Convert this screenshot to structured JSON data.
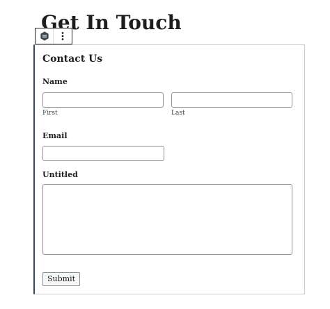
{
  "page": {
    "heading": "Get In Touch"
  },
  "toolbar": {
    "block_icon": "form-block-icon",
    "options_icon": "more-vertical-icon"
  },
  "form": {
    "title": "Contact Us",
    "name_label": "Name",
    "first_label": "First",
    "last_label": "Last",
    "email_label": "Email",
    "untitled_label": "Untitled",
    "submit_label": "Submit"
  },
  "colors": {
    "selection_border": "#3a4752",
    "text": "#1e1e1e",
    "input_border": "#8c8f94"
  }
}
